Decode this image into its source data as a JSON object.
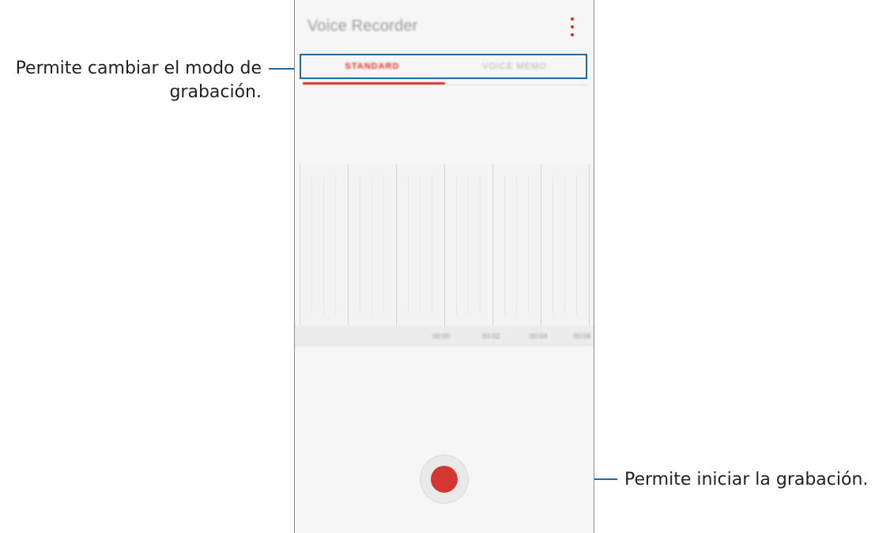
{
  "callouts": {
    "mode_line1": "Permite cambiar el modo de",
    "mode_line2": "grabación.",
    "record": "Permite iniciar la grabación."
  },
  "app": {
    "title": "Voice Recorder",
    "menu_icon": "more-vert-icon"
  },
  "tabs": [
    {
      "label": "STANDARD",
      "active": true
    },
    {
      "label": "VOICE MEMO",
      "active": false
    }
  ],
  "timeline": {
    "labels": [
      "00:00",
      "00:02",
      "00:04",
      "00:06"
    ]
  },
  "colors": {
    "accent": "#d6312b",
    "callout_line": "#1f6aa5"
  }
}
